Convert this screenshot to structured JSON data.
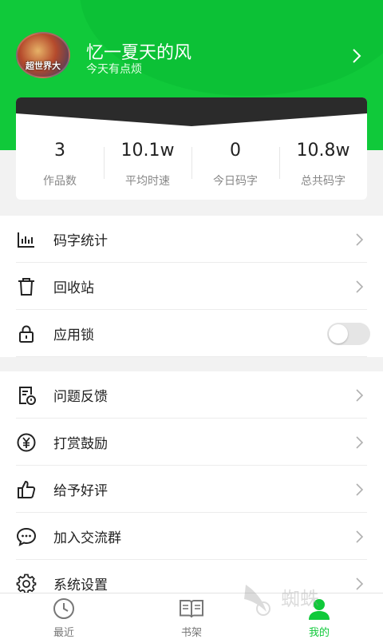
{
  "profile": {
    "avatar_caption": "超世界大",
    "username": "忆一夏天的风",
    "signature": "今天有点烦"
  },
  "stats": [
    {
      "value": "3",
      "label": "作品数"
    },
    {
      "value": "10.1w",
      "label": "平均时速"
    },
    {
      "value": "0",
      "label": "今日码字"
    },
    {
      "value": "10.8w",
      "label": "总共码字"
    }
  ],
  "menu_group1": [
    {
      "label": "码字统计",
      "icon": "bar-chart-icon"
    },
    {
      "label": "回收站",
      "icon": "trash-icon"
    },
    {
      "label": "应用锁",
      "icon": "lock-icon",
      "toggle": false
    }
  ],
  "menu_group2": [
    {
      "label": "问题反馈",
      "icon": "feedback-icon"
    },
    {
      "label": "打赏鼓励",
      "icon": "yen-coin-icon"
    },
    {
      "label": "给予好评",
      "icon": "thumbs-up-icon"
    },
    {
      "label": "加入交流群",
      "icon": "chat-bubble-icon"
    },
    {
      "label": "系统设置",
      "icon": "gear-icon"
    }
  ],
  "tabbar": {
    "items": [
      {
        "label": "最近",
        "icon": "clock-icon",
        "active": false
      },
      {
        "label": "书架",
        "icon": "book-icon",
        "active": false
      },
      {
        "label": "我的",
        "icon": "user-icon",
        "active": true
      }
    ]
  },
  "watermark": {
    "text": "蜘蛛"
  },
  "colors": {
    "accent": "#10c93a",
    "card_ribbon": "#2b2b2b",
    "background": "#f2f2f2"
  }
}
